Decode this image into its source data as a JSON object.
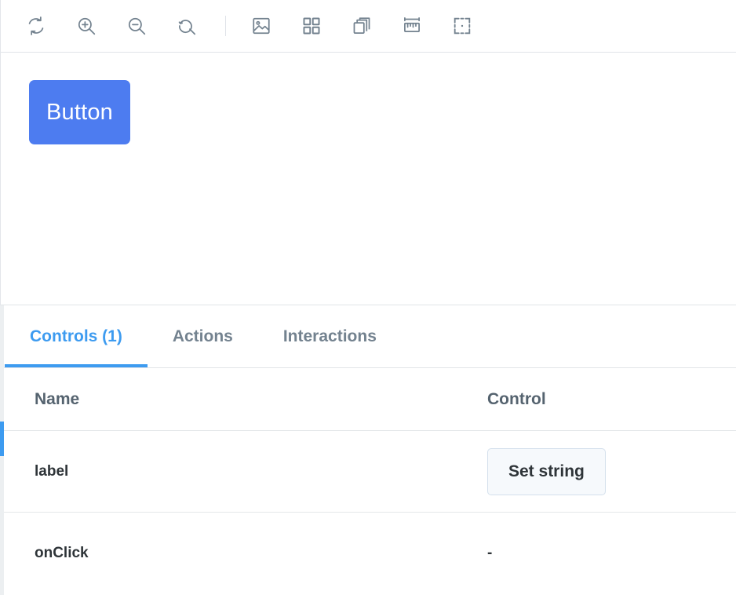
{
  "toolbar": {
    "tools": [
      {
        "name": "remount-icon",
        "label": "Remount component"
      },
      {
        "name": "zoom-in-icon",
        "label": "Zoom in"
      },
      {
        "name": "zoom-out-icon",
        "label": "Zoom out"
      },
      {
        "name": "zoom-reset-icon",
        "label": "Reset zoom"
      },
      {
        "name": "background-image-icon",
        "label": "Change background"
      },
      {
        "name": "grid-icon",
        "label": "Apply grid"
      },
      {
        "name": "layers-icon",
        "label": "Apply outline"
      },
      {
        "name": "ruler-icon",
        "label": "Enable measure"
      },
      {
        "name": "bounding-box-icon",
        "label": "Apply outline"
      }
    ]
  },
  "canvas": {
    "story_button_label": "Button",
    "story_button_color": "#4d7cf0"
  },
  "panel": {
    "tabs": [
      {
        "label": "Controls (1)",
        "active": true
      },
      {
        "label": "Actions",
        "active": false
      },
      {
        "label": "Interactions",
        "active": false
      }
    ],
    "accent_color": "#3d9bf0",
    "table": {
      "headers": {
        "name": "Name",
        "control": "Control"
      },
      "rows": [
        {
          "name": "label",
          "control_type": "button",
          "control_label": "Set string"
        },
        {
          "name": "onClick",
          "control_type": "text",
          "control_label": "-"
        }
      ]
    }
  }
}
